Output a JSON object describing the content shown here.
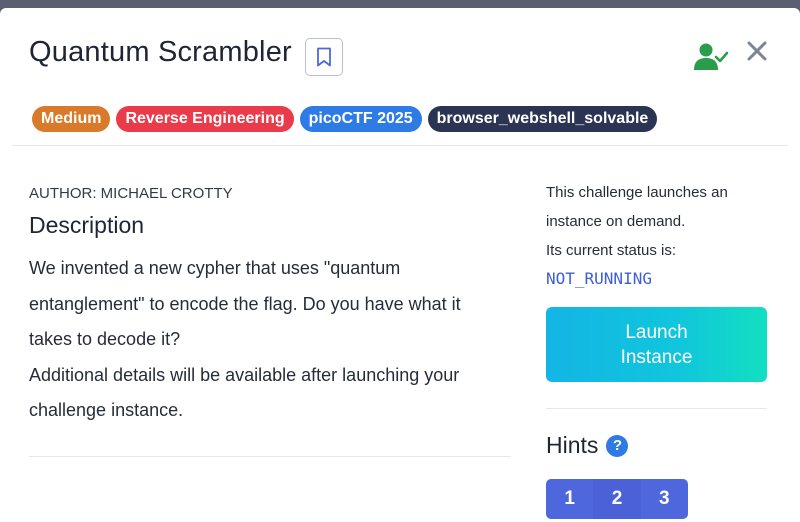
{
  "header": {
    "title": "Quantum Scrambler",
    "icons": {
      "bookmark": "bookmark-icon",
      "solved_status": "user-check-icon",
      "close": "close-icon"
    },
    "tags": [
      {
        "label": "Medium",
        "color": "#d97a2b"
      },
      {
        "label": "Reverse Engineering",
        "color": "#ea3b4a"
      },
      {
        "label": "picoCTF 2025",
        "color": "#2f7be6"
      },
      {
        "label": "browser_webshell_solvable",
        "color": "#2b3553"
      }
    ]
  },
  "main": {
    "author": "AUTHOR: MICHAEL CROTTY",
    "description_heading": "Description",
    "description_lines": [
      "We invented a new cypher that uses \"quantum",
      "entanglement\" to encode the flag. Do you have what it",
      "takes to decode it?",
      "Additional details will be available after launching your",
      "challenge instance."
    ]
  },
  "sidebar": {
    "instance_lines": [
      "This challenge launches an",
      "instance on demand.",
      "Its current status is:"
    ],
    "status": "NOT_RUNNING",
    "launch_button": [
      "Launch",
      "Instance"
    ],
    "hints_heading": "Hints",
    "hint_buttons": [
      "1",
      "2",
      "3"
    ]
  },
  "colors": {
    "accent": "#2f7be6",
    "status_text": "#3d5fd6",
    "solved_green": "#2a9d4a",
    "launch_gradient_start": "#13b5e4",
    "launch_gradient_end": "#12dfc0",
    "hint_button": "#4f67dc"
  }
}
